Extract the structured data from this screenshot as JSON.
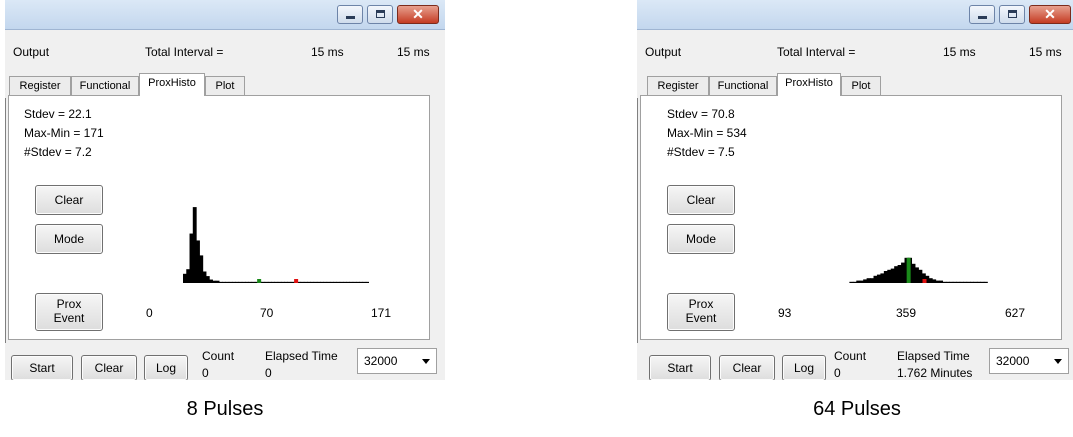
{
  "panels": [
    {
      "output_label": "Output",
      "total_interval_label": "Total Interval =",
      "interval_value_1": "15 ms",
      "interval_value_2": "15 ms",
      "tabs": [
        "Register",
        "Functional",
        "ProxHisto",
        "Plot"
      ],
      "active_tab": "ProxHisto",
      "stats": [
        "Stdev = 22.1",
        "Max-Min = 171",
        "#Stdev = 7.2"
      ],
      "clear_button": "Clear",
      "mode_button": "Mode",
      "prox_event_button_line1": "Prox",
      "prox_event_button_line2": "Event",
      "axis_labels": [
        "0",
        "70",
        "171"
      ],
      "start_button": "Start",
      "bottom_clear_button": "Clear",
      "log_button": "Log",
      "count_label": "Count",
      "count_value": "0",
      "elapsed_label": "Elapsed Time",
      "elapsed_value": "0",
      "buffer_select": "32000",
      "caption": "8 Pulses"
    },
    {
      "output_label": "Output",
      "total_interval_label": "Total Interval =",
      "interval_value_1": "15 ms",
      "interval_value_2": "15 ms",
      "tabs": [
        "Register",
        "Functional",
        "ProxHisto",
        "Plot"
      ],
      "active_tab": "ProxHisto",
      "stats": [
        "Stdev = 70.8",
        "Max-Min = 534",
        "#Stdev = 7.5"
      ],
      "clear_button": "Clear",
      "mode_button": "Mode",
      "prox_event_button_line1": "Prox",
      "prox_event_button_line2": "Event",
      "axis_labels": [
        "93",
        "359",
        "627"
      ],
      "start_button": "Start",
      "bottom_clear_button": "Clear",
      "log_button": "Log",
      "count_label": "Count",
      "count_value": "0",
      "elapsed_label": "Elapsed Time",
      "elapsed_value": "1.762 Minutes",
      "buffer_select": "32000",
      "caption": "64 Pulses"
    }
  ],
  "chart_data": [
    {
      "type": "bar",
      "x_range": [
        0,
        171
      ],
      "bar_color": "#000000",
      "mean_marker_color": "#1a8a1a",
      "limit_marker_color": "#e01010",
      "mean_marker_x": 70,
      "limit_marker_x": 104,
      "bins": [
        [
          0,
          8
        ],
        [
          3,
          12
        ],
        [
          6,
          43
        ],
        [
          9,
          66
        ],
        [
          12,
          37
        ],
        [
          15,
          24
        ],
        [
          18,
          10
        ],
        [
          21,
          6
        ],
        [
          24,
          3
        ],
        [
          27,
          2
        ],
        [
          30,
          2
        ],
        [
          33,
          1
        ],
        [
          36,
          1
        ],
        [
          39,
          1
        ],
        [
          42,
          1
        ],
        [
          45,
          1
        ],
        [
          48,
          1
        ],
        [
          51,
          1
        ],
        [
          54,
          1
        ],
        [
          57,
          1
        ],
        [
          60,
          1
        ],
        [
          63,
          1
        ],
        [
          66,
          1
        ],
        [
          69,
          1
        ],
        [
          72,
          1
        ],
        [
          75,
          1
        ],
        [
          78,
          1
        ],
        [
          81,
          1
        ],
        [
          84,
          1
        ],
        [
          87,
          1
        ],
        [
          90,
          1
        ],
        [
          93,
          1
        ],
        [
          96,
          1
        ],
        [
          99,
          1
        ],
        [
          102,
          1
        ],
        [
          105,
          1
        ],
        [
          108,
          1
        ],
        [
          111,
          1
        ],
        [
          114,
          1
        ],
        [
          117,
          1
        ],
        [
          120,
          1
        ],
        [
          123,
          1
        ],
        [
          126,
          1
        ],
        [
          129,
          1
        ],
        [
          132,
          1
        ],
        [
          135,
          1
        ],
        [
          138,
          1
        ],
        [
          141,
          1
        ],
        [
          144,
          1
        ],
        [
          147,
          1
        ],
        [
          150,
          1
        ],
        [
          153,
          1
        ],
        [
          156,
          1
        ],
        [
          159,
          1
        ],
        [
          162,
          1
        ],
        [
          165,
          1
        ],
        [
          168,
          1
        ]
      ]
    },
    {
      "type": "bar",
      "x_range": [
        93,
        627
      ],
      "bar_color": "#000000",
      "mean_marker_color": "#1a8a1a",
      "limit_marker_color": "#e01010",
      "mean_marker_x": 359,
      "limit_marker_x": 405,
      "bins": [
        [
          187,
          1
        ],
        [
          197,
          1
        ],
        [
          207,
          2
        ],
        [
          217,
          2
        ],
        [
          227,
          3
        ],
        [
          237,
          4
        ],
        [
          247,
          4
        ],
        [
          257,
          6
        ],
        [
          267,
          7
        ],
        [
          277,
          8
        ],
        [
          287,
          10
        ],
        [
          297,
          11
        ],
        [
          307,
          12
        ],
        [
          317,
          14
        ],
        [
          327,
          15
        ],
        [
          337,
          17
        ],
        [
          347,
          21
        ],
        [
          357,
          21
        ],
        [
          367,
          16
        ],
        [
          377,
          13
        ],
        [
          387,
          11
        ],
        [
          397,
          8
        ],
        [
          407,
          6
        ],
        [
          417,
          4
        ],
        [
          427,
          3
        ],
        [
          437,
          2
        ],
        [
          447,
          2
        ],
        [
          457,
          1
        ],
        [
          467,
          1
        ],
        [
          477,
          1
        ],
        [
          487,
          1
        ],
        [
          497,
          1
        ],
        [
          507,
          1
        ],
        [
          517,
          1
        ],
        [
          527,
          1
        ],
        [
          537,
          1
        ],
        [
          547,
          1
        ],
        [
          557,
          1
        ],
        [
          567,
          1
        ],
        [
          577,
          1
        ]
      ]
    }
  ]
}
